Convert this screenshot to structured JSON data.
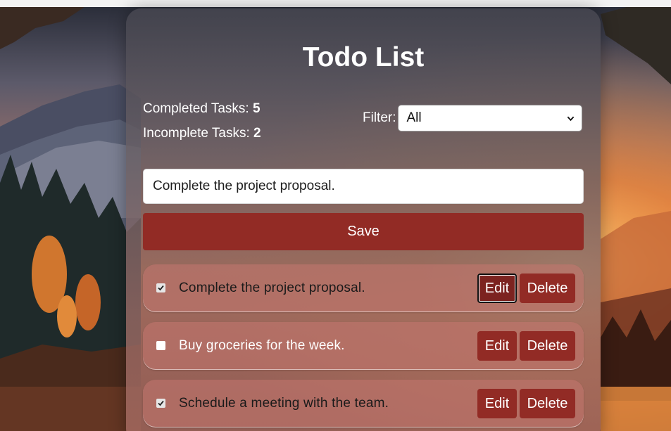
{
  "app": {
    "title": "Todo List"
  },
  "stats": {
    "completed_label": "Completed Tasks:",
    "completed_count": "5",
    "incomplete_label": "Incomplete Tasks:",
    "incomplete_count": "2"
  },
  "filter": {
    "label": "Filter:",
    "selected": "All"
  },
  "editor": {
    "input_value": "Complete the project proposal.",
    "save_label": "Save"
  },
  "tasks": [
    {
      "text": "Complete the project proposal.",
      "checked": true,
      "edit_label": "Edit",
      "delete_label": "Delete"
    },
    {
      "text": "Buy groceries for the week.",
      "checked": false,
      "edit_label": "Edit",
      "delete_label": "Delete"
    },
    {
      "text": "Schedule a meeting with the team.",
      "checked": true,
      "edit_label": "Edit",
      "delete_label": "Delete"
    }
  ],
  "colors": {
    "accent": "#922b25",
    "card_bg": "#6a5f64"
  },
  "icons": {
    "filter_dropdown": "chevron-down-icon",
    "checkbox_mark": "checkmark-icon"
  }
}
